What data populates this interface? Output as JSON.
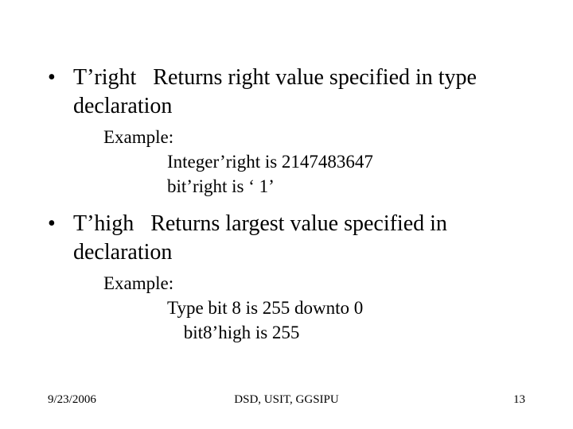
{
  "bullets": [
    {
      "dot": "•",
      "text": "T’right   Returns right value specified in type declaration",
      "example_label": "Example:",
      "lines": [
        "Integer’right is 2147483647",
        "bit’right is ‘ 1’"
      ]
    },
    {
      "dot": "•",
      "text": "T’high   Returns largest value specified in declaration",
      "example_label": "Example:",
      "lines": [
        "Type bit 8 is 255 downto 0",
        " bit8’high is 255"
      ]
    }
  ],
  "footer": {
    "date": "9/23/2006",
    "center": "DSD, USIT, GGSIPU",
    "page": "13"
  }
}
